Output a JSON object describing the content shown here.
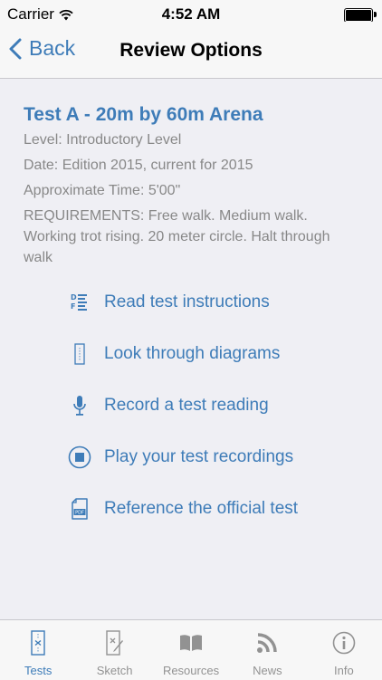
{
  "status": {
    "carrier": "Carrier",
    "time": "4:52 AM"
  },
  "nav": {
    "back_label": "Back",
    "title": "Review Options"
  },
  "test": {
    "title": "Test A - 20m by 60m Arena",
    "level": "Level:  Introductory Level",
    "date": "Date:  Edition 2015, current for 2015",
    "time": "Approximate Time:  5'00\"",
    "requirements": "REQUIREMENTS: Free walk. Medium walk. Working trot rising. 20 meter circle. Halt through walk"
  },
  "options": [
    {
      "label": "Read test instructions",
      "icon": "instructions-icon"
    },
    {
      "label": "Look through diagrams",
      "icon": "diagram-icon"
    },
    {
      "label": "Record a test reading",
      "icon": "microphone-icon"
    },
    {
      "label": "Play your test recordings",
      "icon": "play-recording-icon"
    },
    {
      "label": "Reference the official test",
      "icon": "pdf-icon"
    }
  ],
  "tabs": [
    {
      "label": "Tests",
      "icon": "tests-icon",
      "active": true
    },
    {
      "label": "Sketch",
      "icon": "sketch-icon",
      "active": false
    },
    {
      "label": "Resources",
      "icon": "book-icon",
      "active": false
    },
    {
      "label": "News",
      "icon": "rss-icon",
      "active": false
    },
    {
      "label": "Info",
      "icon": "info-icon",
      "active": false
    }
  ],
  "colors": {
    "accent": "#3e7cb8",
    "text_gray": "#888888",
    "tab_inactive": "#929292",
    "background": "#efeff4"
  }
}
